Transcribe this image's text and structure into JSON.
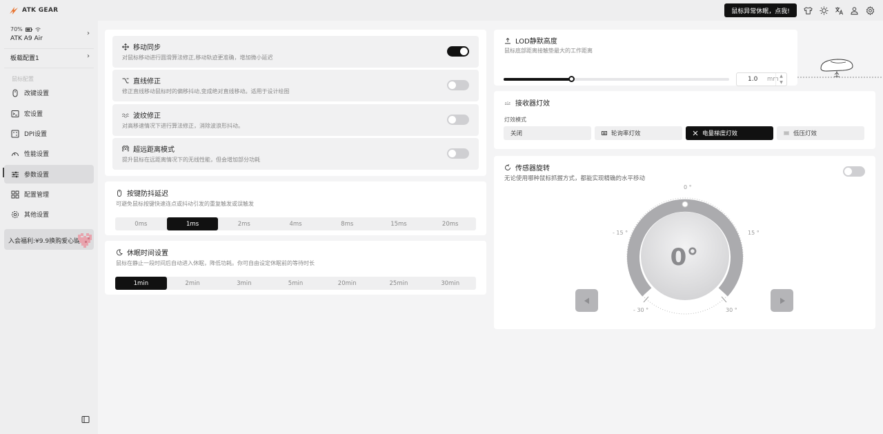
{
  "app": {
    "logo_text": "ATK GEAR"
  },
  "topbar": {
    "alert_button": "鼠标异常休眠，点我!",
    "icons": [
      "shirt-icon",
      "sun-icon",
      "translate-icon",
      "user-icon",
      "gear-icon"
    ]
  },
  "sidebar": {
    "battery": "70%",
    "device_name": "ATK A9 Air",
    "profile": "板载配置1",
    "section_title": "鼠标配置",
    "items": [
      {
        "label": "改键设置",
        "icon": "mouse-icon"
      },
      {
        "label": "宏设置",
        "icon": "terminal-icon"
      },
      {
        "label": "DPI设置",
        "icon": "dpi-icon"
      },
      {
        "label": "性能设置",
        "icon": "gauge-icon"
      },
      {
        "label": "参数设置",
        "icon": "sliders-icon",
        "active": true
      },
      {
        "label": "配置管理",
        "icon": "grid-icon"
      },
      {
        "label": "其他设置",
        "icon": "gear-icon"
      }
    ],
    "promo": "入会福利:¥9.9换购爱心键帽"
  },
  "options": [
    {
      "title": "移动同步",
      "desc": "对鼠标移动进行圆滑算法修正,移动轨迹更准确，增加微小延迟",
      "on": true
    },
    {
      "title": "直线修正",
      "desc": "修正直线移动鼠标时的偏移抖动,变成绝对直线移动。适用于设计绘图",
      "on": false
    },
    {
      "title": "波纹修正",
      "desc": "对高移速情况下进行算法修正，消除波浪形抖动。",
      "on": false
    },
    {
      "title": "超远距离模式",
      "desc": "提升鼠标在远距离情况下的无线性能，但会增加部分功耗",
      "on": false
    }
  ],
  "debounce": {
    "title": "按键防抖延迟",
    "desc": "可避免鼠标按键快速连点或抖动引发的重复触发或误触发",
    "options": [
      "0ms",
      "1ms",
      "2ms",
      "4ms",
      "8ms",
      "15ms",
      "20ms"
    ],
    "selected": "1ms"
  },
  "sleep": {
    "title": "休眠时间设置",
    "desc": "鼠标在静止一段时间后自动进入休眠，降低功耗。你可自由设定休眠前的等待时长",
    "options": [
      "1min",
      "2min",
      "3min",
      "5min",
      "20min",
      "25min",
      "30min"
    ],
    "selected": "1min"
  },
  "lod": {
    "title": "LOD静默高度",
    "desc": "鼠标底部距离接触垫最大的工作距离",
    "value": "1.0",
    "unit": "mm",
    "level": 0.3
  },
  "receiver": {
    "title": "接收器灯效",
    "mode_label": "灯效模式",
    "modes": [
      "关闭",
      "轮询率灯效",
      "电量梯度灯效",
      "低压灯效"
    ],
    "selected": "电量梯度灯效"
  },
  "sensor": {
    "title": "传感器旋转",
    "desc": "无论使用哪种鼠标抓握方式，都能实现精确的水平移动",
    "on": false,
    "angle": "0°",
    "ticks": [
      "0 °",
      "- 15 °",
      "15 °",
      "- 30 °",
      "30 °"
    ]
  },
  "colors": {
    "accent": "#111111",
    "bg": "#f4f4f5",
    "card": "#ffffff"
  }
}
